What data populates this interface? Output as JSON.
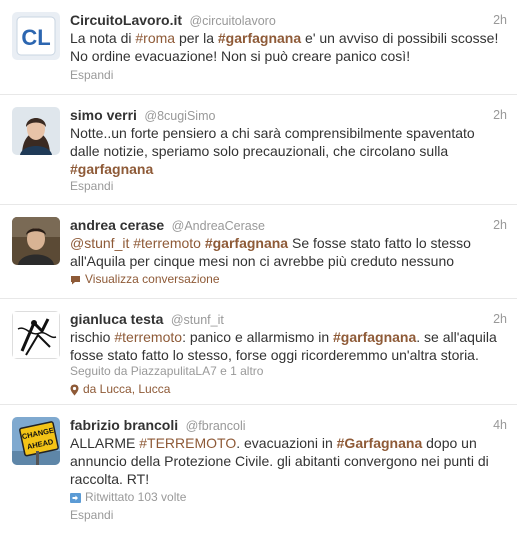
{
  "tweets": [
    {
      "name": "CircuitoLavoro.it",
      "handle": "@circuitolavoro",
      "time": "2h",
      "parts": [
        {
          "t": "La nota di ",
          "c": ""
        },
        {
          "t": "#roma",
          "c": "hl"
        },
        {
          "t": " per la ",
          "c": ""
        },
        {
          "t": "#garfagnana",
          "c": "hl bold"
        },
        {
          "t": " e' un avviso di possibili scosse! No ordine evacuazione! Non si può creare panico così!",
          "c": ""
        }
      ],
      "expand": "Espandi"
    },
    {
      "name": "simo verri",
      "handle": "@8cugiSimo",
      "time": "2h",
      "parts": [
        {
          "t": "Notte..un forte pensiero a chi sarà comprensibilmente spaventato dalle notizie, speriamo solo precauzionali, che circolano sulla ",
          "c": ""
        },
        {
          "t": "#garfagnana",
          "c": "hl bold"
        }
      ],
      "expand": "Espandi"
    },
    {
      "name": "andrea cerase",
      "handle": "@AndreaCerase",
      "time": "2h",
      "parts": [
        {
          "t": "@stunf_it",
          "c": "hl"
        },
        {
          "t": " ",
          "c": ""
        },
        {
          "t": "#terremoto",
          "c": "hl"
        },
        {
          "t": " ",
          "c": ""
        },
        {
          "t": "#garfagnana",
          "c": "hl bold"
        },
        {
          "t": " Se fosse stato fatto lo stesso all'Aquila per cinque mesi non ci avrebbe più creduto nessuno",
          "c": ""
        }
      ],
      "conversation": "Visualizza conversazione"
    },
    {
      "name": "gianluca testa",
      "handle": "@stunf_it",
      "time": "2h",
      "parts": [
        {
          "t": "rischio ",
          "c": ""
        },
        {
          "t": "#terremoto",
          "c": "hl"
        },
        {
          "t": ": panico e allarmismo in ",
          "c": ""
        },
        {
          "t": "#garfagnana",
          "c": "hl bold"
        },
        {
          "t": ". se all'aquila fosse stato fatto lo stesso, forse oggi ricorderemmo un'altra storia.",
          "c": ""
        }
      ],
      "followed_by": "Seguito da PiazzapulitaLA7 e 1 altro",
      "location": "da Lucca, Lucca"
    },
    {
      "name": "fabrizio brancoli",
      "handle": "@fbrancoli",
      "time": "4h",
      "parts": [
        {
          "t": "ALLARME ",
          "c": ""
        },
        {
          "t": "#TERREMOTO",
          "c": "hl"
        },
        {
          "t": ". evacuazioni in ",
          "c": ""
        },
        {
          "t": "#Garfagnana",
          "c": "hl bold"
        },
        {
          "t": " dopo un annuncio della Protezione Civile. gli abitanti convergono nei punti di raccolta. RT!",
          "c": ""
        }
      ],
      "retweeted": "Ritwittato 103 volte",
      "expand": "Espandi"
    }
  ],
  "avatar_labels": {
    "sign_line1": "CHANGE",
    "sign_line2": "AHEAD"
  },
  "colors": {
    "hashtag": "#8e5a37",
    "meta": "#999999",
    "text": "#333333",
    "divider": "#e8e8e8",
    "retweet_icon": "#5b9bd5"
  }
}
